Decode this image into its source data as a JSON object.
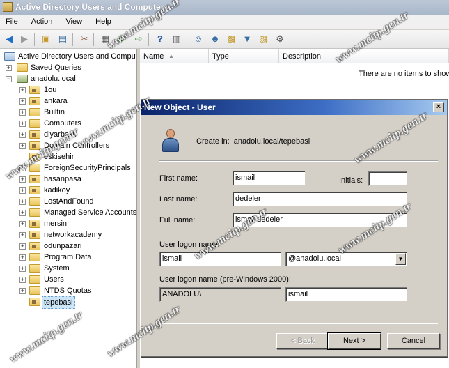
{
  "window": {
    "title": "Active Directory Users and Computers"
  },
  "menu": {
    "items": [
      "File",
      "Action",
      "View",
      "Help"
    ]
  },
  "tree": {
    "root": "Active Directory Users and Comput",
    "saved_queries": "Saved Queries",
    "domain": "anadolu.local",
    "children": [
      "1ou",
      "ankara",
      "Builtin",
      "Computers",
      "diyarbakir",
      "Domain Controllers",
      "eskisehir",
      "ForeignSecurityPrincipals",
      "hasanpasa",
      "kadikoy",
      "LostAndFound",
      "Managed Service Accounts",
      "mersin",
      "networkacademy",
      "odunpazari",
      "Program Data",
      "System",
      "Users",
      "NTDS Quotas",
      "tepebasi"
    ]
  },
  "list": {
    "columns": [
      "Name",
      "Type",
      "Description"
    ],
    "empty_message": "There are no items to show"
  },
  "dialog": {
    "title": "New Object - User",
    "create_in_label": "Create in:",
    "create_in_value": "anadolu.local/tepebasi",
    "first_name_label": "First name:",
    "first_name": "ismail",
    "initials_label": "Initials:",
    "initials": "",
    "last_name_label": "Last name:",
    "last_name": "dedeler",
    "full_name_label": "Full name:",
    "full_name": "ismail dedeler",
    "logon_label": "User logon name:",
    "logon_name": "ismail",
    "domain_suffix": "@anadolu.local",
    "pre2000_label": "User logon name (pre-Windows 2000):",
    "pre2000_domain": "ANADOLU\\",
    "pre2000_name": "ismail",
    "back_button": "< Back",
    "next_button": "Next >",
    "cancel_button": "Cancel",
    "close_glyph": "×"
  },
  "watermark": {
    "text": "www.mcitp.gen.tr"
  }
}
